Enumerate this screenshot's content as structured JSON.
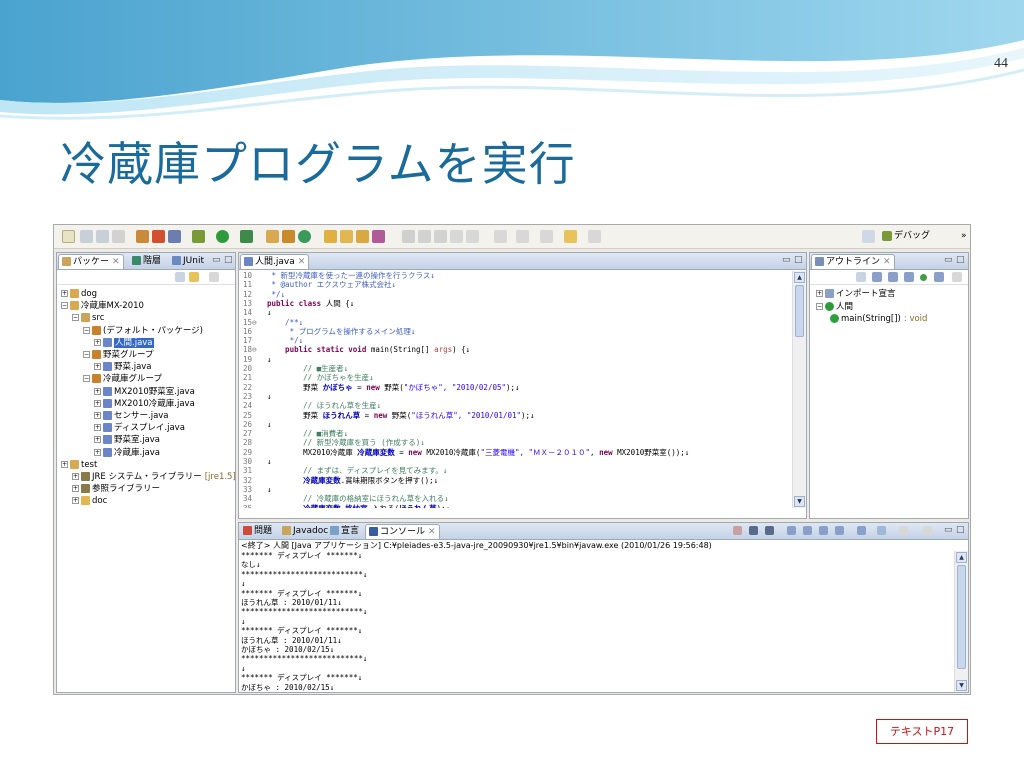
{
  "slide": {
    "page_number": "44",
    "title": "冷蔵庫プログラムを実行",
    "citation": "テキストP17"
  },
  "toolbar": {
    "perspective_label": "デバッグ",
    "overflow": "»"
  },
  "package_explorer": {
    "tabs": [
      "パッケー",
      "階層",
      "JUnit"
    ],
    "tree": [
      {
        "label": "dog",
        "depth": 0,
        "expander": "+",
        "icon": "project-icon"
      },
      {
        "label": "冷蔵庫MX-2010",
        "depth": 0,
        "expander": "−",
        "icon": "project-icon"
      },
      {
        "label": "src",
        "depth": 1,
        "expander": "−",
        "icon": "src-folder-icon"
      },
      {
        "label": "(デフォルト・パッケージ)",
        "depth": 2,
        "expander": "−",
        "icon": "package-icon"
      },
      {
        "label": "人間.java",
        "depth": 3,
        "expander": "+",
        "icon": "java-file-icon",
        "selected": true
      },
      {
        "label": "野菜グループ",
        "depth": 2,
        "expander": "−",
        "icon": "package-icon"
      },
      {
        "label": "野菜.java",
        "depth": 3,
        "expander": "+",
        "icon": "java-file-icon"
      },
      {
        "label": "冷蔵庫グループ",
        "depth": 2,
        "expander": "−",
        "icon": "package-icon"
      },
      {
        "label": "MX2010野菜室.java",
        "depth": 3,
        "expander": "+",
        "icon": "java-file-icon"
      },
      {
        "label": "MX2010冷蔵庫.java",
        "depth": 3,
        "expander": "+",
        "icon": "java-file-icon"
      },
      {
        "label": "センサー.java",
        "depth": 3,
        "expander": "+",
        "icon": "java-file-icon"
      },
      {
        "label": "ディスプレイ.java",
        "depth": 3,
        "expander": "+",
        "icon": "java-file-icon"
      },
      {
        "label": "野菜室.java",
        "depth": 3,
        "expander": "+",
        "icon": "java-file-icon"
      },
      {
        "label": "冷蔵庫.java",
        "depth": 3,
        "expander": "+",
        "icon": "java-file-icon"
      },
      {
        "label": "test",
        "depth": 0,
        "expander": "+",
        "icon": "project-icon"
      },
      {
        "label": "JRE システム・ライブラリー",
        "suffix": "[jre1.5]",
        "depth": 1,
        "expander": "+",
        "icon": "library-icon"
      },
      {
        "label": "参照ライブラリー",
        "depth": 1,
        "expander": "+",
        "icon": "library-icon"
      },
      {
        "label": "doc",
        "depth": 1,
        "expander": "+",
        "icon": "folder-icon"
      }
    ]
  },
  "editor": {
    "tab_label": "人間.java",
    "lines": [
      {
        "n": "10",
        "segs": [
          {
            "t": " * 新型冷蔵庫を使った一連の操作を行うクラス↓",
            "c": "jd"
          }
        ]
      },
      {
        "n": "11",
        "segs": [
          {
            "t": " * @author エクスウェア株式会社↓",
            "c": "jd"
          }
        ]
      },
      {
        "n": "12",
        "segs": [
          {
            "t": " */↓",
            "c": "jd"
          }
        ]
      },
      {
        "n": "13",
        "segs": [
          {
            "t": "public class ",
            "c": "kw"
          },
          {
            "t": "人間 {↓",
            "c": ""
          }
        ]
      },
      {
        "n": "14",
        "segs": [
          {
            "t": "↓",
            "c": ""
          }
        ]
      },
      {
        "n": "15⊖",
        "segs": [
          {
            "t": "    /**↓",
            "c": "jd"
          }
        ]
      },
      {
        "n": "16",
        "segs": [
          {
            "t": "     * プログラムを操作するメイン処理↓",
            "c": "jd"
          }
        ]
      },
      {
        "n": "17",
        "segs": [
          {
            "t": "     */↓",
            "c": "jd"
          }
        ]
      },
      {
        "n": "18⊖",
        "segs": [
          {
            "t": "    public static void ",
            "c": "kw"
          },
          {
            "t": "main(String[] ",
            "c": ""
          },
          {
            "t": "args",
            "c": "arg"
          },
          {
            "t": ") {↓",
            "c": ""
          }
        ]
      },
      {
        "n": "19",
        "segs": [
          {
            "t": "↓",
            "c": ""
          }
        ]
      },
      {
        "n": "20",
        "segs": [
          {
            "t": "        // ■生産者↓",
            "c": "cm"
          }
        ]
      },
      {
        "n": "21",
        "segs": [
          {
            "t": "        // かぼちゃを生産↓",
            "c": "cm"
          }
        ]
      },
      {
        "n": "22",
        "segs": [
          {
            "t": "        野菜 ",
            "c": ""
          },
          {
            "t": "かぼちゃ",
            "c": "fld"
          },
          {
            "t": " = ",
            "c": ""
          },
          {
            "t": "new ",
            "c": "kw"
          },
          {
            "t": "野菜(",
            "c": ""
          },
          {
            "t": "\"かぼちゃ\", \"2010/02/05\"",
            "c": "st"
          },
          {
            "t": ");↓",
            "c": ""
          }
        ]
      },
      {
        "n": "23",
        "segs": [
          {
            "t": "↓",
            "c": ""
          }
        ]
      },
      {
        "n": "24",
        "segs": [
          {
            "t": "        // ほうれん草を生産↓",
            "c": "cm"
          }
        ]
      },
      {
        "n": "25",
        "segs": [
          {
            "t": "        野菜 ",
            "c": ""
          },
          {
            "t": "ほうれん草",
            "c": "fld"
          },
          {
            "t": " = ",
            "c": ""
          },
          {
            "t": "new ",
            "c": "kw"
          },
          {
            "t": "野菜(",
            "c": ""
          },
          {
            "t": "\"ほうれん草\", \"2010/01/01\"",
            "c": "st"
          },
          {
            "t": ");↓",
            "c": ""
          }
        ]
      },
      {
        "n": "26",
        "segs": [
          {
            "t": "↓",
            "c": ""
          }
        ]
      },
      {
        "n": "27",
        "segs": [
          {
            "t": "        // ■消費者↓",
            "c": "cm"
          }
        ]
      },
      {
        "n": "28",
        "segs": [
          {
            "t": "        // 新型冷蔵庫を買う (作成する)↓",
            "c": "cm"
          }
        ]
      },
      {
        "n": "29",
        "segs": [
          {
            "t": "        MX2010冷蔵庫 ",
            "c": ""
          },
          {
            "t": "冷蔵庫変数",
            "c": "fld"
          },
          {
            "t": " = ",
            "c": ""
          },
          {
            "t": "new ",
            "c": "kw"
          },
          {
            "t": "MX2010冷蔵庫(",
            "c": ""
          },
          {
            "t": "\"三菱電機\", \"ＭＸ－２０１０\"",
            "c": "st"
          },
          {
            "t": ", ",
            "c": ""
          },
          {
            "t": "new ",
            "c": "kw"
          },
          {
            "t": "MX2010野菜室());↓",
            "c": ""
          }
        ]
      },
      {
        "n": "30",
        "segs": [
          {
            "t": "↓",
            "c": ""
          }
        ]
      },
      {
        "n": "31",
        "segs": [
          {
            "t": "        // まずは、ディスプレイを見てみます。↓",
            "c": "cm"
          }
        ]
      },
      {
        "n": "32",
        "segs": [
          {
            "t": "        ",
            "c": ""
          },
          {
            "t": "冷蔵庫変数",
            "c": "fld"
          },
          {
            "t": ".賞味期限ボタンを押す();↓",
            "c": ""
          }
        ]
      },
      {
        "n": "33",
        "segs": [
          {
            "t": "↓",
            "c": ""
          }
        ]
      },
      {
        "n": "34",
        "segs": [
          {
            "t": "        // 冷蔵庫の格納室にほうれん草を入れる↓",
            "c": "cm"
          }
        ]
      },
      {
        "n": "35",
        "segs": [
          {
            "t": "        ",
            "c": ""
          },
          {
            "t": "冷蔵庫変数",
            "c": "fld"
          },
          {
            "t": ".",
            "c": ""
          },
          {
            "t": "格納室",
            "c": "fld"
          },
          {
            "t": ".入れる(",
            "c": ""
          },
          {
            "t": "ほうれん草",
            "c": "fld"
          },
          {
            "t": ");↓",
            "c": ""
          }
        ]
      },
      {
        "n": "36",
        "segs": [
          {
            "t": "↓",
            "c": ""
          }
        ]
      },
      {
        "n": "37",
        "segs": [
          {
            "t": "        // ディスプレイを見てみます↓",
            "c": "cm"
          }
        ]
      }
    ]
  },
  "outline": {
    "tab_label": "アウトライン",
    "items": [
      {
        "label": "インポート宣言",
        "depth": 0,
        "expander": "+",
        "icon": "imports-icon"
      },
      {
        "label": "人間",
        "depth": 0,
        "expander": "−",
        "icon": "class-icon"
      },
      {
        "label": "main(String[])",
        "suffix": ": void",
        "depth": 1,
        "expander": "",
        "icon": "method-icon"
      }
    ]
  },
  "console": {
    "tabs": [
      "問題",
      "Javadoc",
      "宣言",
      "コンソール"
    ],
    "header": "<終了> 人間 [Java アプリケーション] C:¥pleiades-e3.5-java-jre_20090930¥jre1.5¥bin¥javaw.exe (2010/01/26 19:56:48)",
    "lines": [
      "******* ディスプレイ *******↓",
      "なし↓",
      "***************************↓",
      "↓",
      "******* ディスプレイ *******↓",
      "ほうれん草 : 2010/01/11↓",
      "***************************↓",
      "↓",
      "******* ディスプレイ *******↓",
      "ほうれん草 : 2010/01/11↓",
      "かぼちゃ : 2010/02/15↓",
      "***************************↓",
      "↓",
      "******* ディスプレイ *******↓",
      "かぼちゃ : 2010/02/15↓"
    ]
  },
  "colors": {
    "title": "#1a6a9a",
    "citation": "#cc1111",
    "selection": "#3569c9"
  }
}
